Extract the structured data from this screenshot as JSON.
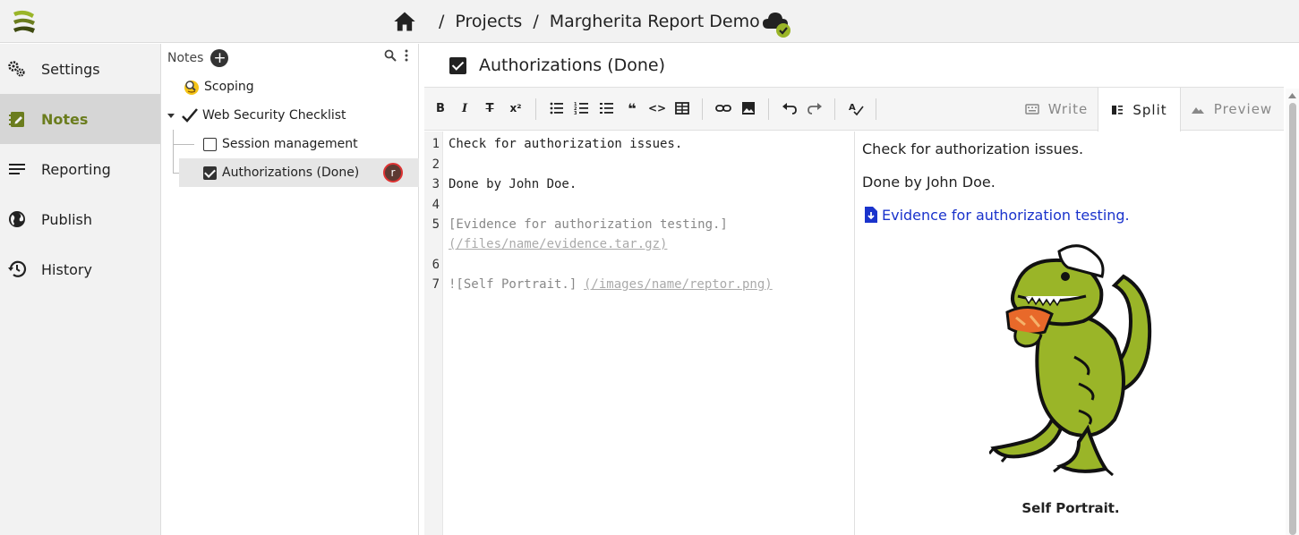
{
  "header": {
    "breadcrumbs": [
      "Projects",
      "Margherita Report Demo"
    ],
    "separator": "/"
  },
  "nav": {
    "items": [
      {
        "label": "Settings",
        "icon": "gears-icon"
      },
      {
        "label": "Notes",
        "icon": "notebook-icon"
      },
      {
        "label": "Reporting",
        "icon": "lines-icon"
      },
      {
        "label": "Publish",
        "icon": "globe-icon"
      },
      {
        "label": "History",
        "icon": "history-icon"
      }
    ],
    "active": "Notes"
  },
  "tree": {
    "title": "Notes",
    "items": [
      {
        "label": "Scoping",
        "icon": "emoji-search-icon"
      },
      {
        "label": "Web Security Checklist",
        "icon": "checkmark-icon"
      },
      {
        "label": "Session management",
        "checked": false
      },
      {
        "label": "Authorizations (Done)",
        "checked": true,
        "assignee": "r"
      }
    ]
  },
  "note": {
    "title": "Authorizations (Done)",
    "checked": true
  },
  "toolbar": {
    "modes": [
      "Write",
      "Split",
      "Preview"
    ],
    "active_mode": "Split"
  },
  "editor": {
    "lines": [
      {
        "n": "1",
        "text": "Check for authorization issues."
      },
      {
        "n": "2",
        "text": ""
      },
      {
        "n": "3",
        "text": "Done by John Doe."
      },
      {
        "n": "4",
        "text": ""
      },
      {
        "n": "5",
        "text": "[Evidence for authorization testing.]",
        "link": "(/files/name/evidence.tar.gz)"
      },
      {
        "n": "6",
        "text": ""
      },
      {
        "n": "7",
        "text": "![Self Portrait.]",
        "link": "(/images/name/reptor.png)"
      }
    ]
  },
  "preview": {
    "p1": "Check for authorization issues.",
    "p2": "Done by John Doe.",
    "link": "Evidence for authorization testing.",
    "caption": "Self Portrait."
  },
  "colors": {
    "accent": "#6b7d1e",
    "link": "#1a33cc",
    "dino": "#9ab528"
  }
}
